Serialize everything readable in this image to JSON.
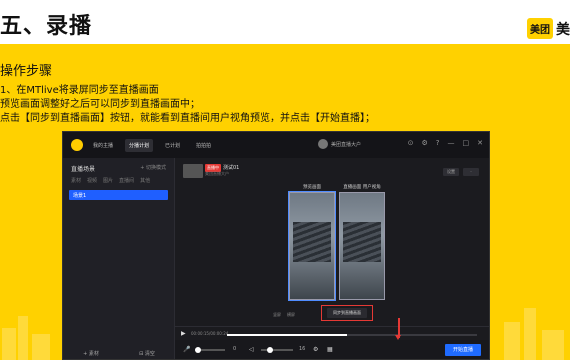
{
  "slide": {
    "title": "五、录播",
    "brand_badge": "美团",
    "brand_text": "美",
    "section_title": "操作步骤",
    "steps": [
      "1、在MTlive将录屏同步至直播画面",
      "预览画面调整好之后可以同步到直播画面中；",
      "点击【同步到直播画面】按钮，就能看到直播间用户视角预览，并点击【开始直播】；"
    ]
  },
  "app": {
    "nav": [
      "我的主播",
      "分播计划",
      "已计划",
      "拍拍拍"
    ],
    "user_name": "美团直播大户",
    "win_controls": [
      "⊙",
      "⚙",
      "?",
      "—",
      "□",
      "✕"
    ],
    "sidebar": {
      "title": "直播场景",
      "action": "+ 切换模式",
      "tabs": [
        "素材",
        "视频",
        "图片",
        "直播间",
        "其他"
      ],
      "selected_item": "场景1",
      "bottom_left": "+ 素材",
      "bottom_right": "⊟ 清空"
    },
    "room": {
      "live_tag": "直播中",
      "name": "测试01",
      "subtitle": "美团直播大户",
      "buttons": [
        "设置",
        "·"
      ]
    },
    "preview": {
      "left_label": "预览画面",
      "right_label": "直播画面 用户视角",
      "mode_btns": [
        "竖屏",
        "横屏"
      ],
      "sync_button": "同步到直播画面"
    },
    "playback": {
      "time": "00:00:15/00:00:24",
      "progress": 0.48
    },
    "controls": {
      "volume": "0",
      "zoom": "16",
      "start_button": "开始直播"
    }
  },
  "colors": {
    "background": "#ffd100",
    "accent": "#1f6bff",
    "highlight": "#e53935"
  }
}
